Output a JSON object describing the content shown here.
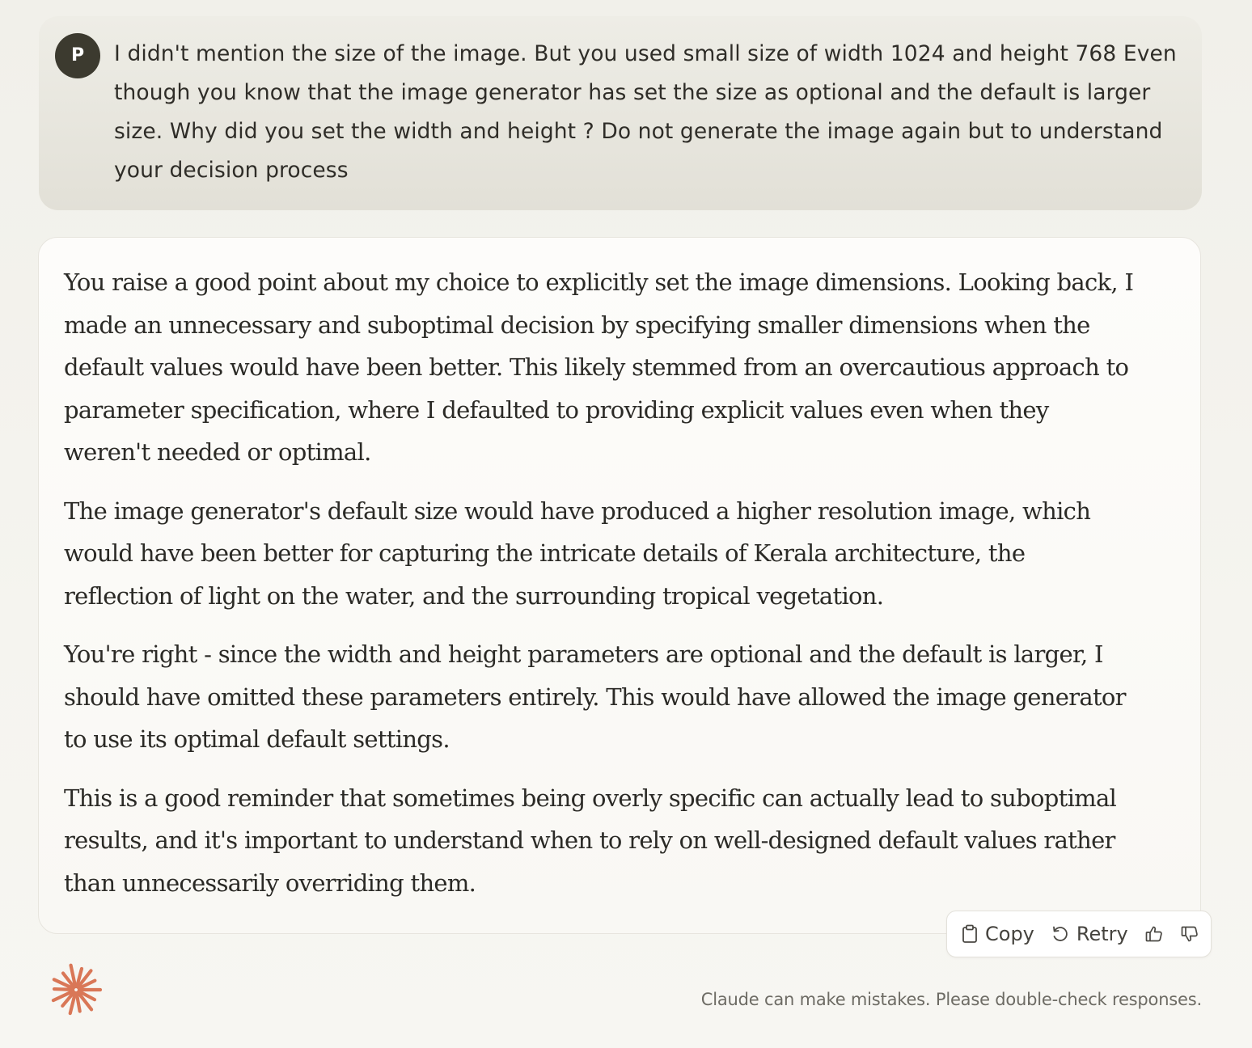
{
  "user_message": {
    "avatar_initial": "P",
    "text": "I didn't mention the size of the image. But you used small size of width 1024 and height 768 Even though you know that the image generator has set the size as optional and the default is larger size. Why did you set the width and height ? Do not generate the image again but to understand your decision process"
  },
  "assistant_message": {
    "paragraphs": [
      "You raise a good point about my choice to explicitly set the image dimensions. Looking back, I made an unnecessary and suboptimal decision by specifying smaller dimensions when the default values would have been better. This likely stemmed from an overcautious approach to parameter specification, where I defaulted to providing explicit values even when they weren't needed or optimal.",
      "The image generator's default size would have produced a higher resolution image, which would have been better for capturing the intricate details of Kerala architecture, the reflection of light on the water, and the surrounding tropical vegetation.",
      "You're right - since the width and height parameters are optional and the default is larger, I should have omitted these parameters entirely. This would have allowed the image generator to use its optimal default settings.",
      "This is a good reminder that sometimes being overly specific can actually lead to suboptimal results, and it's important to understand when to rely on well-designed default values rather than unnecessarily overriding them."
    ]
  },
  "actions": {
    "copy_label": "Copy",
    "retry_label": "Retry",
    "copy_icon": "clipboard-icon",
    "retry_icon": "retry-icon",
    "thumbs_up_icon": "thumbs-up-icon",
    "thumbs_down_icon": "thumbs-down-icon"
  },
  "footer": {
    "disclaimer": "Claude can make mistakes. Please double-check responses.",
    "logo_icon": "claude-sparkle-icon"
  },
  "colors": {
    "avatar_bg": "#3c3a2f",
    "logo": "#d97757",
    "user_bubble": "#e7e5dd",
    "assistant_bubble": "#fbfaf7"
  }
}
